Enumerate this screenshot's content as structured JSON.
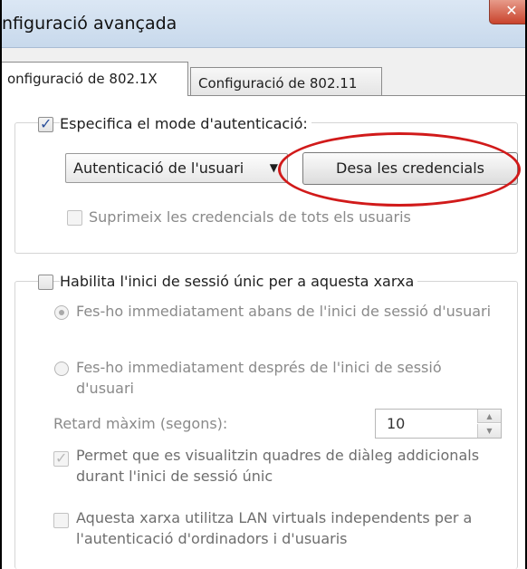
{
  "window": {
    "title": "nfiguració avançada",
    "close_glyph": "✕"
  },
  "tabs": [
    {
      "label": "onfiguració de 802.1X",
      "active": true
    },
    {
      "label": "Configuració de 802.11",
      "active": false
    }
  ],
  "auth_group": {
    "specify_mode_label": "Especifica el mode d'autenticació:",
    "specify_mode_checked": true,
    "mode_select_value": "Autenticació de l'usuari",
    "save_credentials_label": "Desa les credencials",
    "delete_credentials_label": "Suprimeix les credencials de tots els usuaris",
    "delete_credentials_checked": false
  },
  "sso_group": {
    "enable_sso_label": "Habilita l'inici de sessió únic per a aquesta xarxa",
    "enable_sso_checked": false,
    "radio_before_label": "Fes-ho immediatament abans de l'inici de sessió d'usuari",
    "radio_after_label_line1": "Fes-ho immediatament després de l'inici de sessió",
    "radio_after_label_line2": "d'usuari",
    "max_delay_label": "Retard màxim (segons):",
    "max_delay_value": "10",
    "allow_dialogs_line1": "Permet que es visualitzin quadres de diàleg addicionals",
    "allow_dialogs_line2": "durant l'inici de sessió únic",
    "allow_dialogs_checked": true,
    "vlan_line1": "Aquesta xarxa utilitza LAN virtuals independents per a",
    "vlan_line2": "l'autenticació d'ordinadors i d'usuaris",
    "vlan_checked": false
  },
  "colors": {
    "highlight_oval": "#d11a1a",
    "checkmark": "#2a4f9a"
  }
}
